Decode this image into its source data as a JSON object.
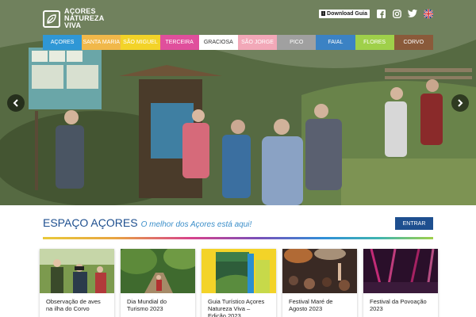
{
  "logo": {
    "line1": "AÇORES",
    "line2": "NATUREZA",
    "line3": "VIVA"
  },
  "top_bar": {
    "download_label": "Download Guia",
    "social_icons": [
      "facebook-icon",
      "instagram-icon",
      "twitter-icon",
      "uk-flag-icon"
    ]
  },
  "nav": [
    {
      "label": "AÇORES",
      "color": "#2f97d6"
    },
    {
      "label": "SANTA MARIA",
      "color": "#f1b84a"
    },
    {
      "label": "SÃO MIGUEL",
      "color": "#f3d328"
    },
    {
      "label": "TERCEIRA",
      "color": "#e04f9c"
    },
    {
      "label": "GRACIOSA",
      "color": "#ffffff"
    },
    {
      "label": "SÃO JORGE",
      "color": "#f2a8b8"
    },
    {
      "label": "PICO",
      "color": "#a0a0a0"
    },
    {
      "label": "FAIAL",
      "color": "#3b82c4"
    },
    {
      "label": "FLORES",
      "color": "#9fd04a"
    },
    {
      "label": "CORVO",
      "color": "#8a5a3a"
    }
  ],
  "espaco": {
    "title": "ESPAÇO AÇORES",
    "subtitle": "O melhor dos Açores está aqui!",
    "button": "ENTRAR"
  },
  "cards": [
    {
      "title": "Observação de aves na ilha do Corvo"
    },
    {
      "title": "Dia Mundial do Turismo 2023"
    },
    {
      "title": "Guia Turístico Açores Natureza Viva – Edição 2023"
    },
    {
      "title": "Festival Maré de Agosto 2023"
    },
    {
      "title": "Festival da Povoação 2023"
    }
  ]
}
